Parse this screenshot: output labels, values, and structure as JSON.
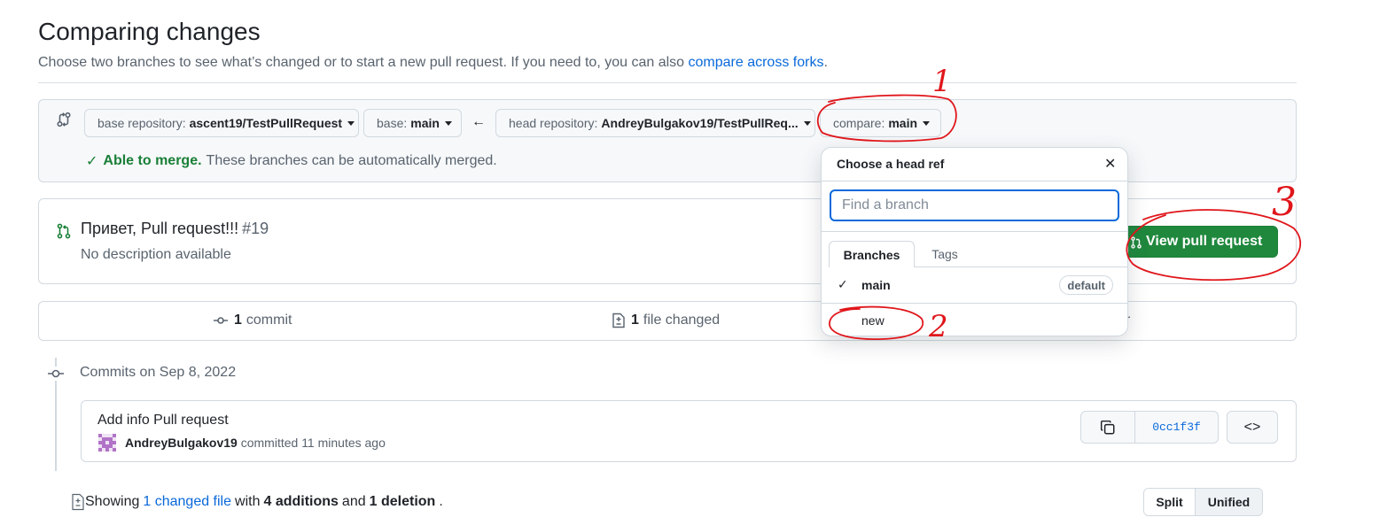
{
  "header": {
    "title": "Comparing changes",
    "subtitle": "Choose two branches to see what’s changed or to start a new pull request. If you need to, you can also",
    "subtitle_link": "compare across forks",
    "subtitle_end": "."
  },
  "range": {
    "base_repo_label": "base repository:",
    "base_repo_value": "ascent19/TestPullRequest",
    "base_label": "base:",
    "base_value": "main",
    "head_repo_label": "head repository:",
    "head_repo_value": "AndreyBulgakov19/TestPullReq...",
    "compare_label": "compare:",
    "compare_value": "main",
    "merge_ok": "Able to merge.",
    "merge_text": "These branches can be automatically merged."
  },
  "pull_request": {
    "title": "Привет, Pull request!!!",
    "number": "#19",
    "description": "No description available",
    "view_button": "View pull request"
  },
  "stats": {
    "commits_count": "1",
    "commits_label": "commit",
    "files_count": "1",
    "files_label": "file changed",
    "trailing": "r"
  },
  "commits": {
    "date_label": "Commits on Sep 8, 2022",
    "items": [
      {
        "title": "Add info Pull request",
        "author": "AndreyBulgakov19",
        "action": "committed",
        "time": "11 minutes ago",
        "sha": "0cc1f3f"
      }
    ]
  },
  "files": {
    "showing": "Showing",
    "changed_link": "1 changed file",
    "with": "with",
    "additions": "4 additions",
    "and": "and",
    "deletions": "1 deletion",
    "end": ".",
    "split_label": "Split",
    "unified_label": "Unified"
  },
  "dropdown": {
    "header": "Choose a head ref",
    "placeholder": "Find a branch",
    "tab_branches": "Branches",
    "tab_tags": "Tags",
    "branches": [
      {
        "name": "main",
        "badge": "default",
        "selected": true
      },
      {
        "name": "new",
        "badge": "",
        "selected": false
      }
    ]
  },
  "annotations": {
    "mark1": "1",
    "mark2": "2",
    "mark3": "3",
    "color": "#e0161b"
  },
  "colors": {
    "accent": "#0969da",
    "success": "#1f883d",
    "success_text": "#1a7f37"
  }
}
